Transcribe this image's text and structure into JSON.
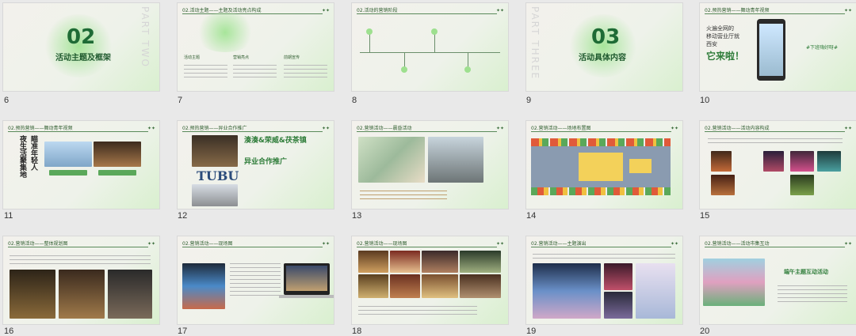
{
  "slides": [
    {
      "n": "6",
      "title": "活动主题及框架",
      "big": "02",
      "vert": "PART TWO"
    },
    {
      "n": "7",
      "header": "02.活动主题——主题及活动亮点构成",
      "labels": [
        "活动主题",
        "营销亮点",
        "前期宣传"
      ]
    },
    {
      "n": "8",
      "header": "02.活动的营销阶段"
    },
    {
      "n": "9",
      "title": "活动具体内容",
      "big": "03",
      "vert": "PART THREE"
    },
    {
      "n": "10",
      "header": "02.预热营销——舞动青年视频",
      "txt1": "火遍全网的",
      "txt2": "移动营业厅就",
      "txt3": "西安",
      "txt4": "它来啦！",
      "tag": "#下班嗨好呀#"
    },
    {
      "n": "11",
      "header": "02.预热营销——舞动青年视频",
      "vert1": "瞄准年轻人",
      "vert2": "夜生活聚集地"
    },
    {
      "n": "12",
      "header": "02.预热营销——异业合作推广",
      "title1": "湊湊&荣威&茯茶镇",
      "title2": "异业合作推广",
      "logo": "TUBU"
    },
    {
      "n": "13",
      "header": "02.营销活动——晨昏活动"
    },
    {
      "n": "14",
      "header": "02.营销活动——场地布置图"
    },
    {
      "n": "15",
      "header": "02.营销活动——活动内容构成"
    },
    {
      "n": "16",
      "header": "02.营销活动——整体规划图"
    },
    {
      "n": "17",
      "header": "02.营销活动——现场图"
    },
    {
      "n": "18",
      "header": "02.营销活动——现场图"
    },
    {
      "n": "19",
      "header": "02.营销活动——主题演出"
    },
    {
      "n": "20",
      "header": "02.营销活动——活动市集互动",
      "sub": "端午主题互动活动"
    }
  ]
}
